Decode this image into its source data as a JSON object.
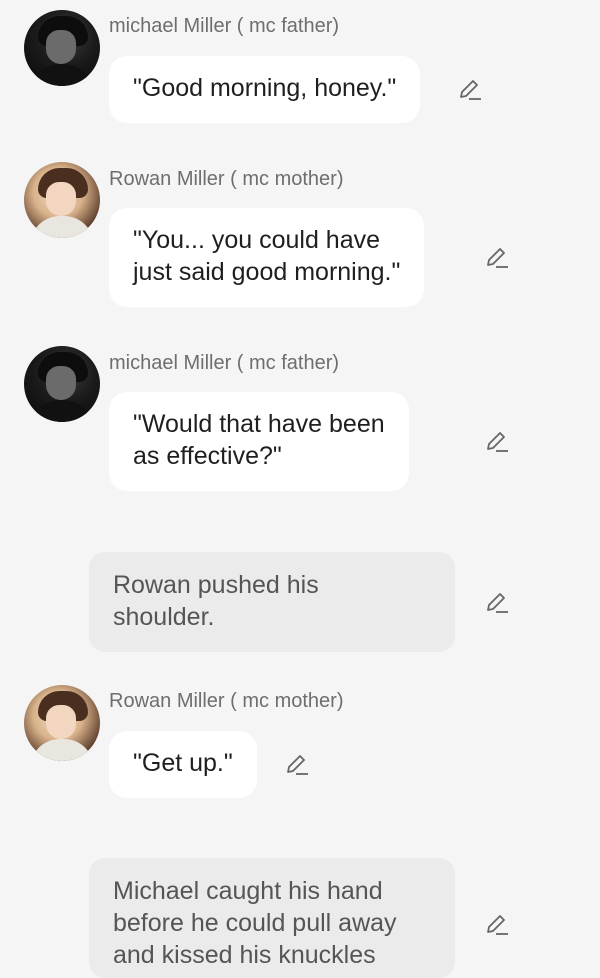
{
  "messages": [
    {
      "type": "dialogue",
      "speaker": "michael Miller ( mc father)",
      "text": "\"Good morning, honey.\"",
      "avatar": "dark"
    },
    {
      "type": "dialogue",
      "speaker": "Rowan Miller ( mc mother)",
      "text_lines": [
        "\"You... you could have",
        "just said good morning.\""
      ],
      "avatar": "light"
    },
    {
      "type": "dialogue",
      "speaker": "michael Miller ( mc father)",
      "text_lines": [
        "\"Would that have been",
        "as effective?\""
      ],
      "avatar": "dark"
    },
    {
      "type": "narration",
      "text_lines": [
        "Rowan pushed his",
        "shoulder."
      ]
    },
    {
      "type": "dialogue",
      "speaker": "Rowan Miller ( mc mother)",
      "text": "\"Get up.\"",
      "avatar": "light"
    },
    {
      "type": "narration",
      "text_lines": [
        "Michael caught his hand",
        "before he could pull away",
        "and kissed his knuckles"
      ]
    }
  ],
  "icons": {
    "edit": "pencil-edit-icon",
    "avatar": "character-avatar"
  },
  "colors": {
    "background": "#f5f5f5",
    "bubble": "#ffffff",
    "narration": "#ebebeb",
    "speaker": "#6e6e6e"
  }
}
